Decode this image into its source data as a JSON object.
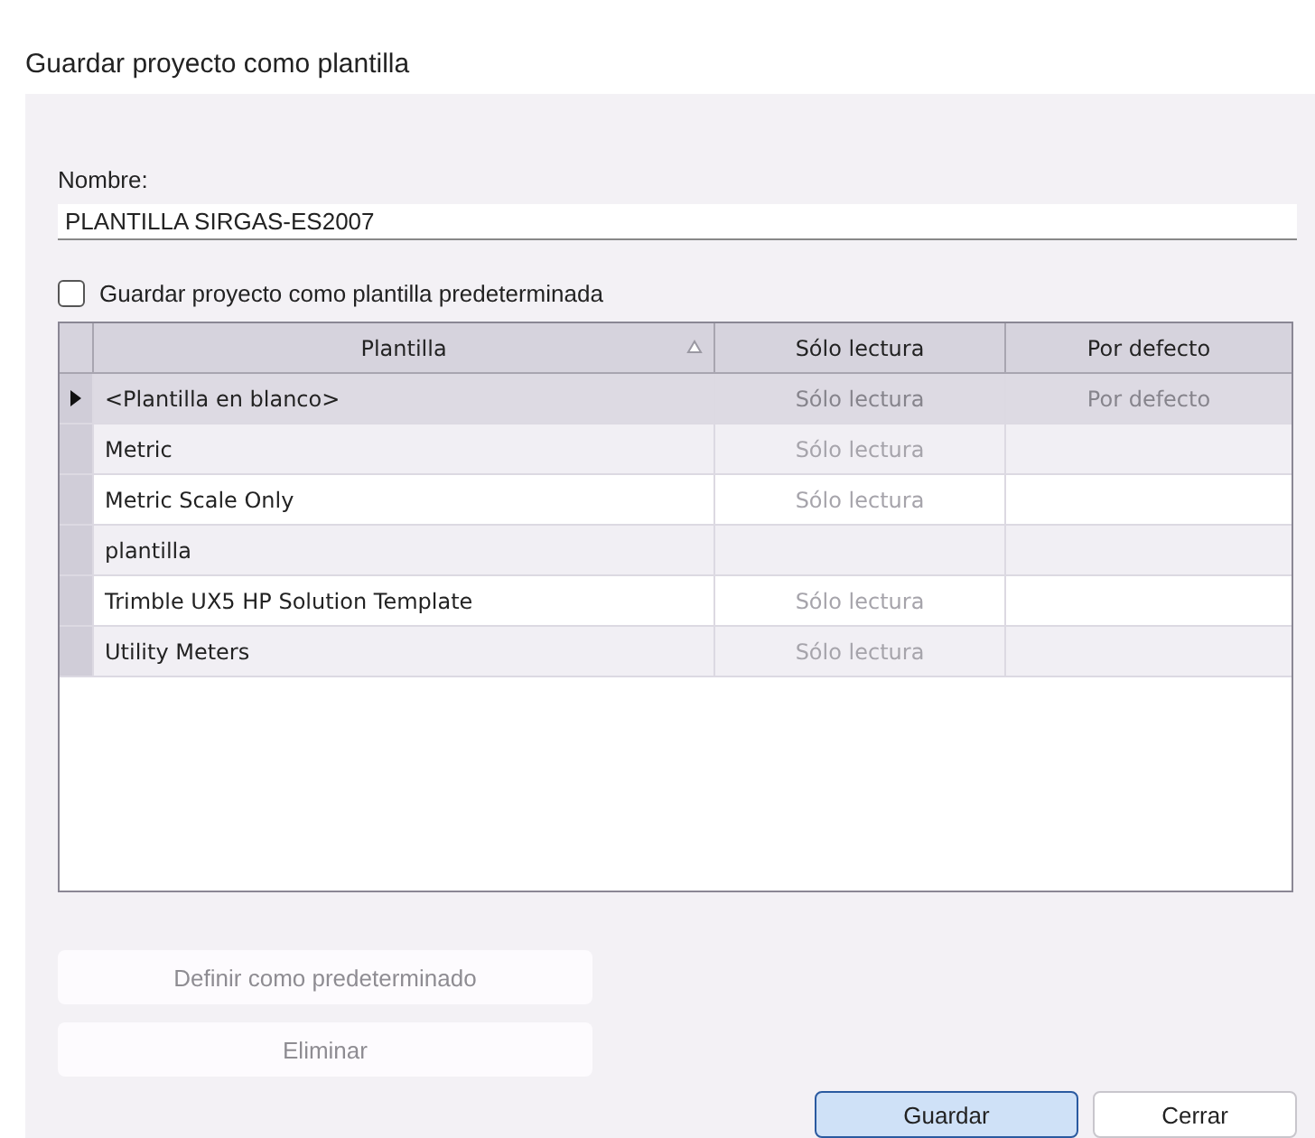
{
  "window": {
    "title": "Guardar proyecto como plantilla"
  },
  "name_field": {
    "label": "Nombre:",
    "value": "PLANTILLA SIRGAS-ES2007"
  },
  "default_checkbox": {
    "label": "Guardar proyecto como plantilla predeterminada",
    "checked": false
  },
  "table": {
    "columns": [
      {
        "label": "Plantilla",
        "sorted": true
      },
      {
        "label": "Sólo lectura",
        "sorted": false
      },
      {
        "label": "Por defecto",
        "sorted": false
      }
    ],
    "rows": [
      {
        "name": "<Plantilla en blanco>",
        "read_only": "Sólo lectura",
        "default": "Por defecto",
        "selected": true
      },
      {
        "name": "Metric",
        "read_only": "Sólo lectura",
        "selected": false
      },
      {
        "name": "Metric Scale Only",
        "read_only": "Sólo lectura",
        "selected": false
      },
      {
        "name": "plantilla",
        "selected": false
      },
      {
        "name": "Trimble UX5 HP Solution Template",
        "read_only": "Sólo lectura",
        "selected": false
      },
      {
        "name": "Utility Meters",
        "read_only": "Sólo lectura",
        "selected": false
      }
    ]
  },
  "side_buttons": [
    {
      "label": "Definir como predeterminado",
      "disabled": true
    },
    {
      "label": "Eliminar",
      "disabled": true
    }
  ],
  "footer_buttons": [
    {
      "label": "Guardar",
      "default": true
    },
    {
      "label": "Cerrar",
      "default": false
    }
  ]
}
